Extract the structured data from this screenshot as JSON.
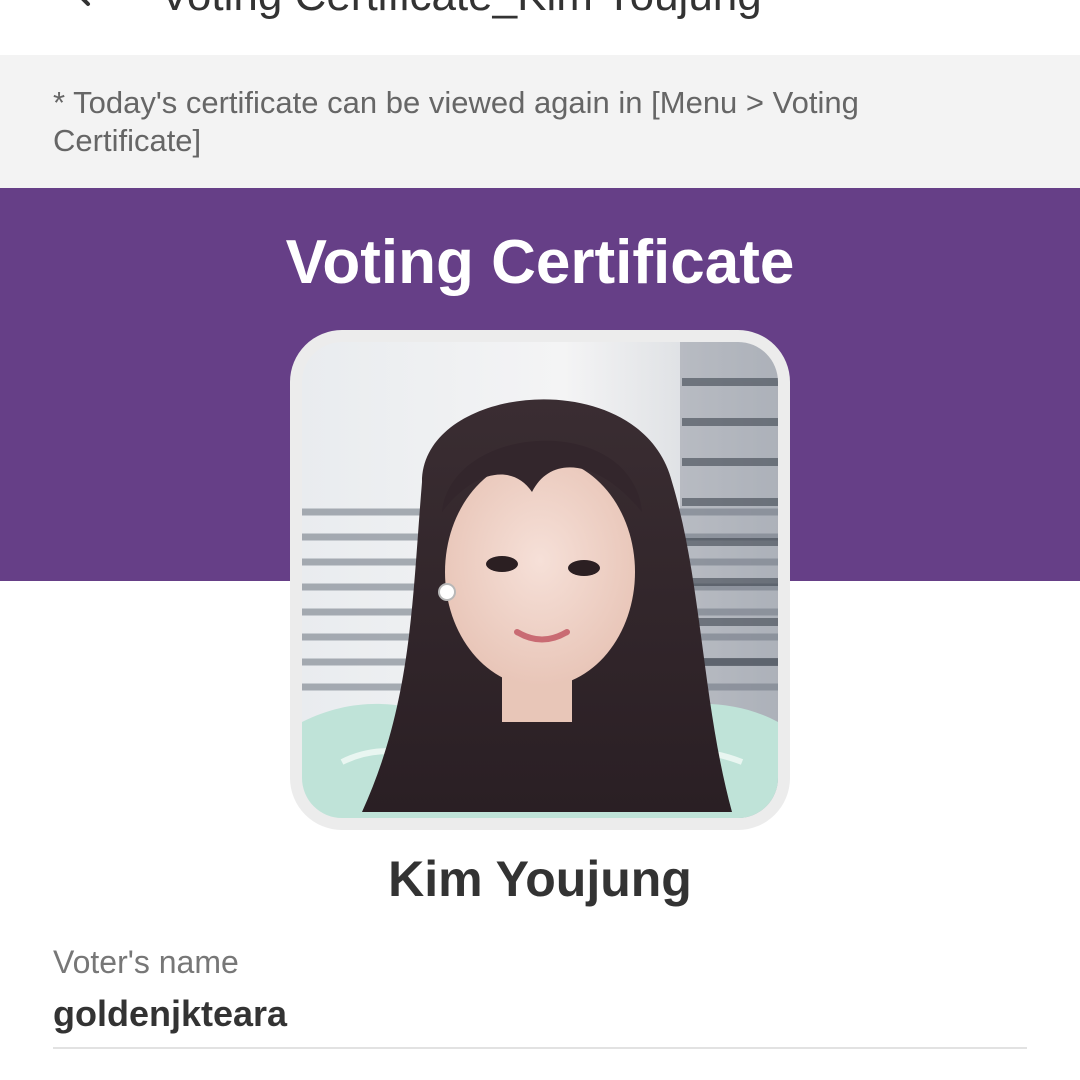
{
  "app_bar": {
    "title": "Voting Certificate_Kim Youjung",
    "back_icon": "back-arrow-icon"
  },
  "notice": {
    "text": "* Today's certificate can be viewed again in [Menu > Voting Certificate]"
  },
  "certificate": {
    "title": "Voting Certificate",
    "candidate_name": "Kim Youjung",
    "voter_label": "Voter's name",
    "voter_name": "goldenjkteara"
  },
  "colors": {
    "header_purple": "#663f87",
    "notice_bg": "#f3f3f3",
    "frame_border": "#ececec",
    "text_dark": "#333333",
    "text_muted": "#777777"
  }
}
